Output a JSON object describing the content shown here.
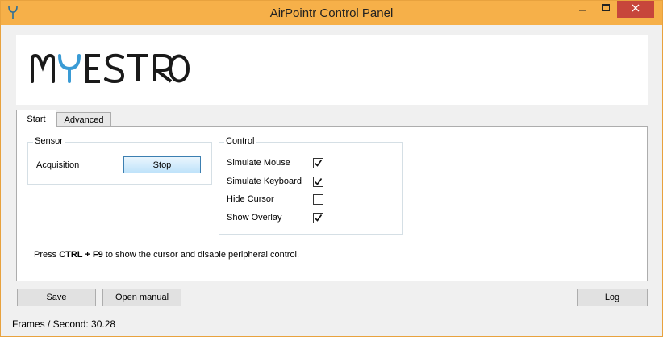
{
  "window": {
    "title": "AirPointr Control Panel",
    "accent_color": "#f6b049",
    "close_color": "#c7463b"
  },
  "titlebar_buttons": [
    "minimize-icon",
    "maximize-icon",
    "close-icon"
  ],
  "logo": {
    "text": "MYESTRO",
    "colors": [
      "#1a1a1a",
      "#3a9bd5"
    ]
  },
  "tabs": [
    {
      "label": "Start",
      "active": true
    },
    {
      "label": "Advanced",
      "active": false
    }
  ],
  "sensor": {
    "group_label": "Sensor",
    "acquisition_label": "Acquisition",
    "stop_label": "Stop"
  },
  "control": {
    "group_label": "Control",
    "options": [
      {
        "label": "Simulate Mouse",
        "checked": true
      },
      {
        "label": "Simulate Keyboard",
        "checked": true
      },
      {
        "label": "Hide Cursor",
        "checked": false
      },
      {
        "label": "Show Overlay",
        "checked": true
      }
    ]
  },
  "hint": {
    "prefix": "Press ",
    "keys": "CTRL + F9",
    "suffix": " to show the cursor and disable peripheral control."
  },
  "buttons": {
    "save": "Save",
    "open_manual": "Open manual",
    "log": "Log"
  },
  "status": {
    "fps_text": "Frames / Second: 30.28"
  }
}
